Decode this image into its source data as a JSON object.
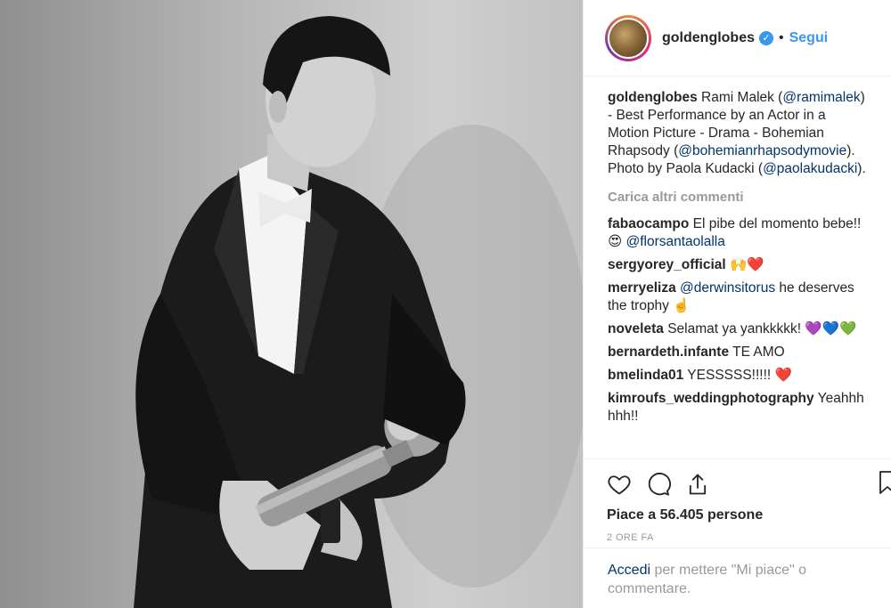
{
  "post": {
    "username": "goldenglobes",
    "follow_label": "Segui",
    "separator": "•",
    "verified_glyph": "✓",
    "colors": {
      "accent": "#3897f0",
      "mention": "#003569",
      "muted": "#999999"
    }
  },
  "caption": {
    "user": "goldenglobes",
    "text_1": " Rami Malek (",
    "mention_1": "@ramimalek",
    "text_2": ") - Best Performance by an Actor in a Motion Picture - Drama - Bohemian Rhapsody (",
    "mention_2": "@bohemianrhapsodymovie",
    "text_3": "). Photo by Paola Kudacki (",
    "mention_3": "@paolakudacki",
    "text_4": ")."
  },
  "load_more": "Carica altri commenti",
  "comments": [
    {
      "user": "fabaocampo",
      "text": " El pibe del momento bebe!! 😍 ",
      "mention": "@florsantaolalla",
      "tail": ""
    },
    {
      "user": "sergyorey_official",
      "text": " 🙌❤️",
      "mention": "",
      "tail": ""
    },
    {
      "user": "merryeliza",
      "text": " ",
      "mention": "@derwinsitorus",
      "tail": " he deserves the trophy ☝️"
    },
    {
      "user": "noveleta",
      "text": " Selamat ya yankkkkk! 💜💙💚",
      "mention": "",
      "tail": ""
    },
    {
      "user": "bernardeth.infante",
      "text": " TE AMO",
      "mention": "",
      "tail": ""
    },
    {
      "user": "bmelinda01",
      "text": " YESSSSS!!!!! ❤️",
      "mention": "",
      "tail": ""
    },
    {
      "user": "kimroufs_weddingphotography",
      "text": " Yeahhh hhh!!",
      "mention": "",
      "tail": ""
    }
  ],
  "actions": {
    "icons": [
      "heart-icon",
      "comment-icon",
      "share-icon",
      "bookmark-icon"
    ],
    "likes": "Piace a 56.405 persone",
    "time": "2 ORE FA"
  },
  "login": {
    "link": "Accedi",
    "text": " per mettere \"Mi piace\" o commentare."
  }
}
